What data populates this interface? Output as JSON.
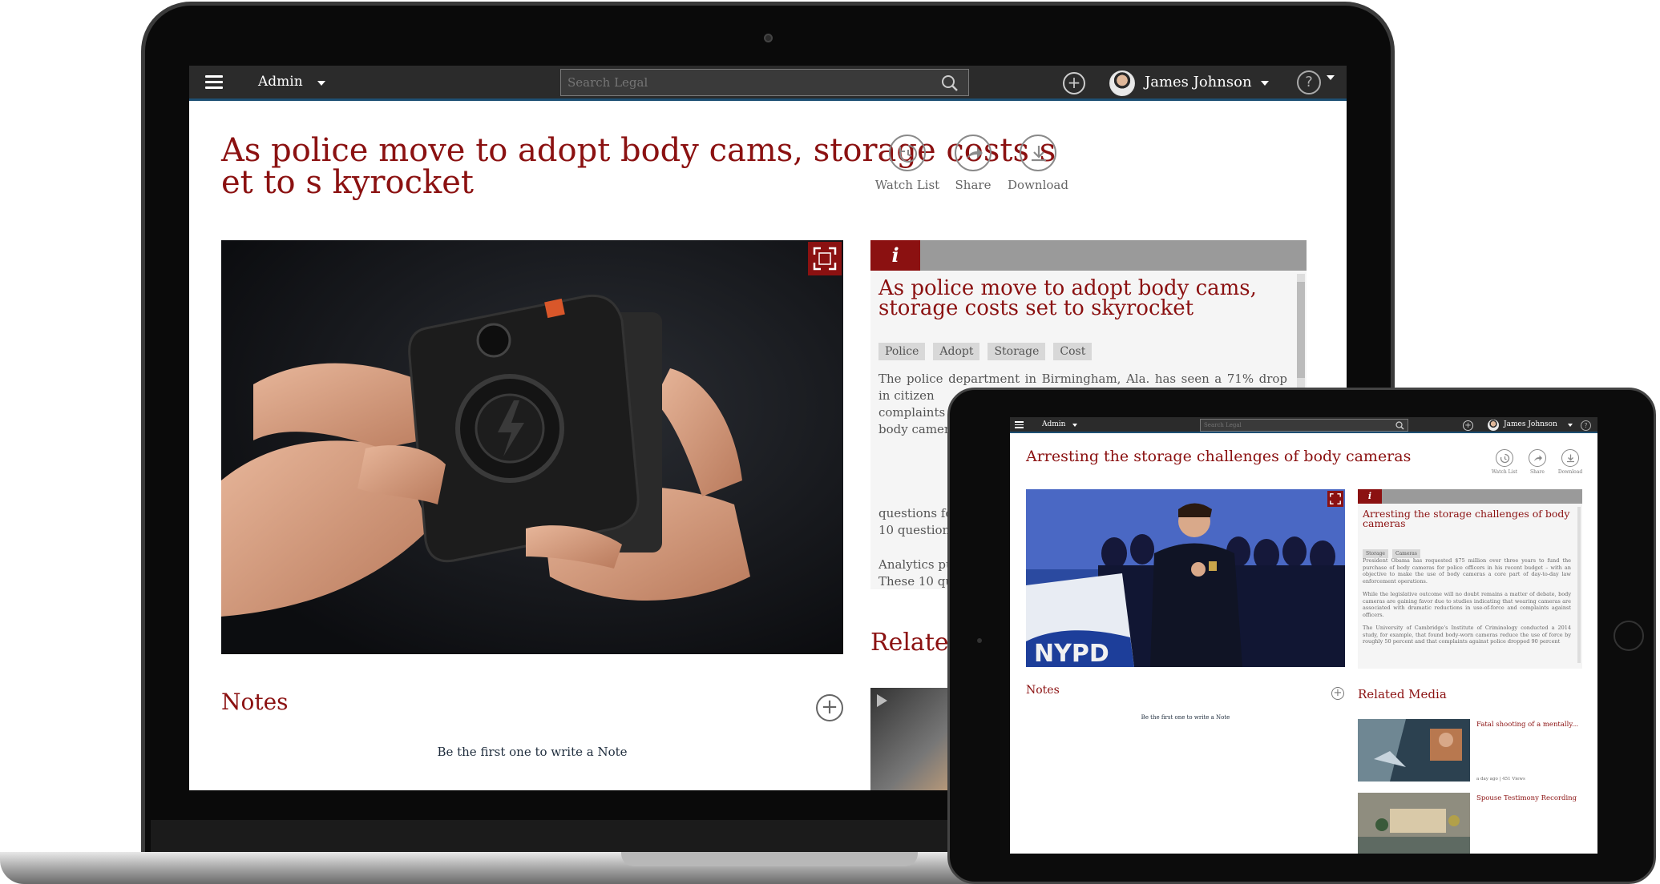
{
  "topbar": {
    "admin_label": "Admin",
    "search_placeholder": "Search Legal",
    "user_name": "James Johnson"
  },
  "laptop": {
    "article_title": "As police move to adopt body cams, storage costs set to s kyrocket",
    "actions": [
      {
        "label": "Watch List",
        "icon": "watch-list-icon"
      },
      {
        "label": "Share",
        "icon": "share-icon"
      },
      {
        "label": "Download",
        "icon": "download-icon"
      }
    ],
    "info_icon": "i",
    "info_title": "As police move to adopt body cams, storage costs set to skyrocket",
    "tags": [
      "Police",
      "Adopt",
      "Storage",
      "Cost"
    ],
    "info_body_lines": [
      "The police department in Birmingham, Ala. has seen a 71% drop in citizen",
      "complaints --",
      "body cameras",
      "questions for",
      "10 questions",
      "Analytics pu",
      "These 10 que"
    ],
    "notes_title": "Notes",
    "notes_empty": "Be the first one to write a Note",
    "related_title": "Related"
  },
  "tablet": {
    "article_title": "Arresting the storage challenges of body cameras",
    "actions": [
      {
        "label": "Watch List",
        "icon": "watch-list-icon"
      },
      {
        "label": "Share",
        "icon": "share-icon"
      },
      {
        "label": "Download",
        "icon": "download-icon"
      }
    ],
    "info_title": "Arresting the storage challenges of body cameras",
    "tags": [
      "Storage",
      "Cameras"
    ],
    "info_paragraphs": [
      "President Obama has requested $75 million over three years to fund the purchase of body cameras for police officers in his recent budget – with an objective to make the use of body cameras a core part of day-to-day law enforcement operations.",
      "While the legislative outcome will no doubt remains a matter of debate, body cameras are gaining favor due to studies indicating that wearing cameras are associated with dramatic reductions in use-of-force and complaints against officers.",
      "The University of Cambridge's Institute of Criminology conducted a 2014 study, for example, that found body-worn cameras reduce the use of force by roughly 50 percent and that complaints against police dropped 90 percent"
    ],
    "notes_title": "Notes",
    "notes_empty": "Be the first one to write a Note",
    "related_title": "Related Media",
    "related_items": [
      {
        "title": "Fatal shooting of a mentally...",
        "meta": "a day ago | 451 Views"
      },
      {
        "title": "Spouse Testimony Recording",
        "meta": ""
      }
    ]
  },
  "colors": {
    "accent": "#8b1111",
    "topbar": "#2b2b2b",
    "topbar_border": "#1d4f73"
  }
}
